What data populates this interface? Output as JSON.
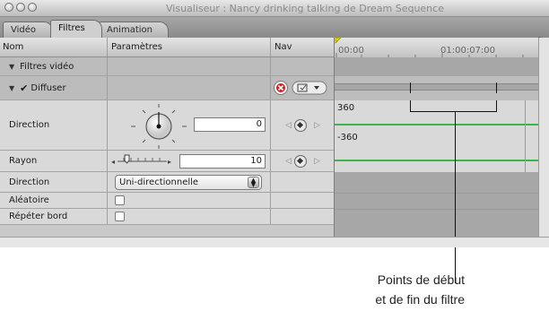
{
  "window": {
    "title": "Visualiseur : Nancy drinking talking de Dream Sequence"
  },
  "tabs": [
    {
      "label": "Vidéo",
      "active": false
    },
    {
      "label": "Filtres",
      "active": true
    },
    {
      "label": "Animation",
      "active": false
    }
  ],
  "columns": {
    "name": "Nom",
    "params": "Paramètres",
    "nav": "Nav"
  },
  "timeline": {
    "start_time": "00:00",
    "mid_time": "01:00:07:00",
    "value_max": "360",
    "value_min": "-360"
  },
  "rows": {
    "filters_group": "Filtres vidéo",
    "filter_name": "Diffuser",
    "direction_label": "Direction",
    "direction_value": "0",
    "radius_label": "Rayon",
    "radius_value": "10",
    "direction2_label": "Direction",
    "direction2_value": "Uni-directionnelle",
    "random_label": "Aléatoire",
    "repeat_label": "Répéter bord"
  },
  "callout": {
    "line1": "Points de début",
    "line2": "et de fin du filtre"
  },
  "colors": {
    "keyframe_green": "#3fb24a",
    "reset_red": "#cc2222"
  }
}
